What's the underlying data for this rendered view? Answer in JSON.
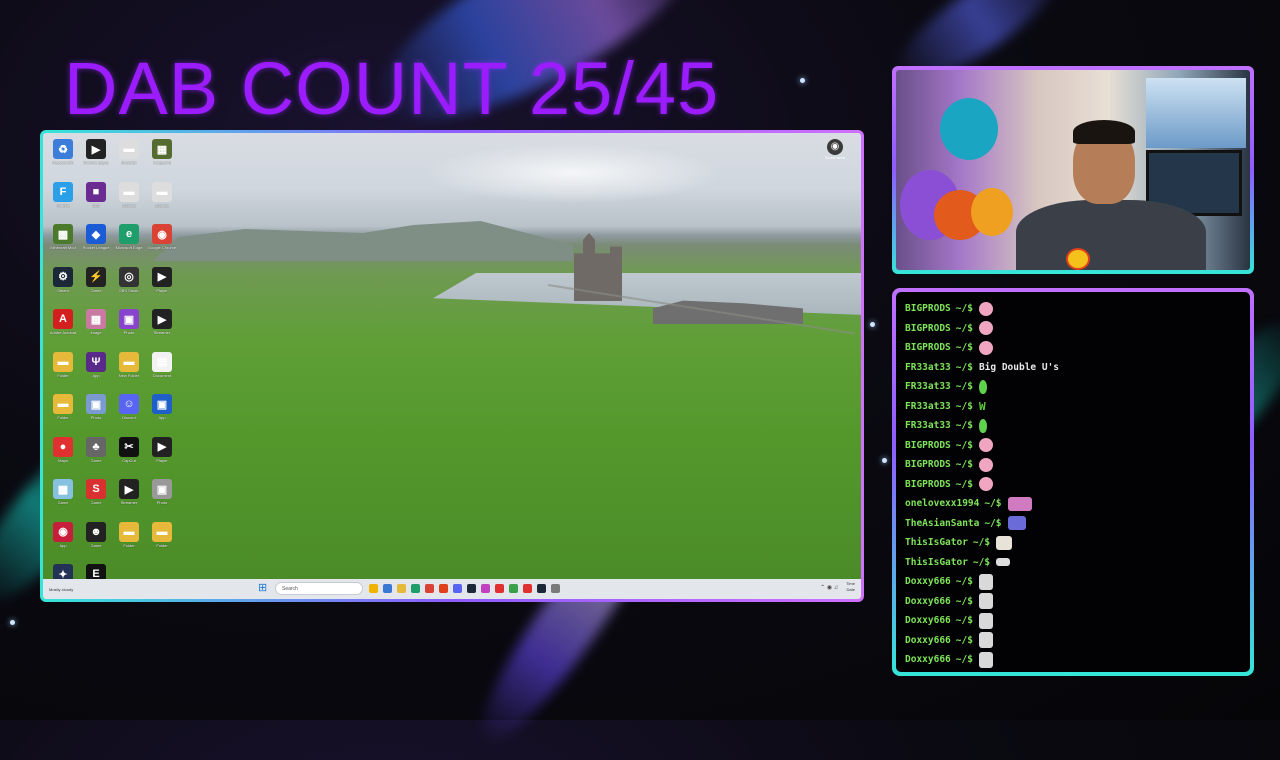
{
  "overlay": {
    "title": "DAB COUNT 25/45"
  },
  "desktop": {
    "icons": [
      {
        "label": "Recycle Bin",
        "icon": "recycle-bin-icon",
        "color": "#3b7dd8",
        "glyph": "♻"
      },
      {
        "label": "Chrome player",
        "icon": "player-icon",
        "color": "#222222",
        "glyph": "▶"
      },
      {
        "label": "Rockstar",
        "icon": "rockstar-icon",
        "color": "#dddddd",
        "glyph": "▬"
      },
      {
        "label": "Image.png",
        "icon": "image-icon",
        "color": "#556b2f",
        "glyph": "▦"
      },
      {
        "label": "Fortnite",
        "icon": "fortnite-icon",
        "color": "#2b9fe8",
        "glyph": "F"
      },
      {
        "label": "OBS",
        "icon": "app-icon",
        "color": "#6a2c91",
        "glyph": "■"
      },
      {
        "label": "Shortcut",
        "icon": "link-icon",
        "color": "#dddddd",
        "glyph": "▬"
      },
      {
        "label": "Shortcut",
        "icon": "link-icon",
        "color": "#dddddd",
        "glyph": "▬"
      },
      {
        "label": "Minecraft Mod",
        "icon": "game-icon",
        "color": "#4b7a2b",
        "glyph": "▩"
      },
      {
        "label": "Rocket League",
        "icon": "rocket-league-icon",
        "color": "#1c5bd6",
        "glyph": "◆"
      },
      {
        "label": "Microsoft Edge",
        "icon": "edge-icon",
        "color": "#1e9e6a",
        "glyph": "e"
      },
      {
        "label": "Google Chrome",
        "icon": "chrome-icon",
        "color": "#d94234",
        "glyph": "◉"
      },
      {
        "label": "Steam",
        "icon": "steam-icon",
        "color": "#1b2838",
        "glyph": "⚙"
      },
      {
        "label": "Game",
        "icon": "game-icon",
        "color": "#222222",
        "glyph": "⚡"
      },
      {
        "label": "OBS Studio",
        "icon": "obs-icon",
        "color": "#333333",
        "glyph": "◎"
      },
      {
        "label": "Player",
        "icon": "player-icon",
        "color": "#222222",
        "glyph": "▶"
      },
      {
        "label": "Adobe Acrobat",
        "icon": "acrobat-icon",
        "color": "#d41f1f",
        "glyph": "A"
      },
      {
        "label": "Image",
        "icon": "image-icon",
        "color": "#c97aa0",
        "glyph": "▦"
      },
      {
        "label": "Photo",
        "icon": "photo-icon",
        "color": "#8844cc",
        "glyph": "▣"
      },
      {
        "label": "Streamer",
        "icon": "player-icon",
        "color": "#222222",
        "glyph": "▶"
      },
      {
        "label": "Folder",
        "icon": "folder-icon",
        "color": "#e6b93a",
        "glyph": "▬"
      },
      {
        "label": "App",
        "icon": "app-icon",
        "color": "#5a2a8a",
        "glyph": "Ψ"
      },
      {
        "label": "New Folder",
        "icon": "folder-icon",
        "color": "#e6b93a",
        "glyph": "▬"
      },
      {
        "label": "Document",
        "icon": "document-icon",
        "color": "#f2f2f2",
        "glyph": "▤"
      },
      {
        "label": "Folder",
        "icon": "folder-icon",
        "color": "#e6b93a",
        "glyph": "▬"
      },
      {
        "label": "Photo",
        "icon": "photo-icon",
        "color": "#7a9ad0",
        "glyph": "▣"
      },
      {
        "label": "Discord",
        "icon": "discord-icon",
        "color": "#5865f2",
        "glyph": "☺"
      },
      {
        "label": "App",
        "icon": "app-icon",
        "color": "#1e5fc8",
        "glyph": "▣"
      },
      {
        "label": "Maps",
        "icon": "map-pin-icon",
        "color": "#e03030",
        "glyph": "●"
      },
      {
        "label": "Game",
        "icon": "game-icon",
        "color": "#666666",
        "glyph": "♣"
      },
      {
        "label": "CapCut",
        "icon": "capcut-icon",
        "color": "#111111",
        "glyph": "✂"
      },
      {
        "label": "Player",
        "icon": "player-icon",
        "color": "#222222",
        "glyph": "▶"
      },
      {
        "label": "Game",
        "icon": "game-icon",
        "color": "#88c0e0",
        "glyph": "▩"
      },
      {
        "label": "Game",
        "icon": "game-icon",
        "color": "#d93030",
        "glyph": "S"
      },
      {
        "label": "Streamer",
        "icon": "player-icon",
        "color": "#222222",
        "glyph": "▶"
      },
      {
        "label": "Photo",
        "icon": "photo-icon",
        "color": "#999999",
        "glyph": "▣"
      },
      {
        "label": "App",
        "icon": "app-icon",
        "color": "#c81e3c",
        "glyph": "◉"
      },
      {
        "label": "Game",
        "icon": "game-icon",
        "color": "#222222",
        "glyph": "☻"
      },
      {
        "label": "Folder",
        "icon": "folder-icon",
        "color": "#e6b93a",
        "glyph": "▬"
      },
      {
        "label": "Folder",
        "icon": "folder-icon",
        "color": "#e6b93a",
        "glyph": "▬"
      },
      {
        "label": "App",
        "icon": "app-icon",
        "color": "#223355",
        "glyph": "✦"
      },
      {
        "label": "Epic Games",
        "icon": "epic-games-icon",
        "color": "#111111",
        "glyph": "E"
      }
    ],
    "screenshot_widget": {
      "icon": "screenshot-icon",
      "glyph": "◉",
      "label": "Screenshot"
    },
    "taskbar": {
      "weather": "Mostly cloudy",
      "search_placeholder": "Search",
      "apps": [
        "#f0b400",
        "#3a78d4",
        "#e6b93a",
        "#1e9e6a",
        "#d94234",
        "#e0401a",
        "#5865f2",
        "#1b2838",
        "#c040c0",
        "#e03030",
        "#3aa04a",
        "#e03030",
        "#1b2838",
        "#7a7a7a"
      ],
      "time": "Time",
      "date": "Date"
    }
  },
  "webcam": {
    "caption": ""
  },
  "chat": {
    "prompt": "~/$",
    "messages": [
      {
        "user": "BIGPRODS",
        "emote": "e-pink",
        "text": ""
      },
      {
        "user": "BIGPRODS",
        "emote": "e-pink",
        "text": ""
      },
      {
        "user": "BIGPRODS",
        "emote": "e-pink",
        "text": ""
      },
      {
        "user": "FR33at33",
        "emote": "",
        "text": "Big Double U's"
      },
      {
        "user": "FR33at33",
        "emote": "e-green",
        "text": ""
      },
      {
        "user": "FR33at33",
        "emote": "e-w",
        "text": ""
      },
      {
        "user": "FR33at33",
        "emote": "e-green",
        "text": ""
      },
      {
        "user": "BIGPRODS",
        "emote": "e-pink",
        "text": ""
      },
      {
        "user": "BIGPRODS",
        "emote": "e-pink",
        "text": ""
      },
      {
        "user": "BIGPRODS",
        "emote": "e-pink",
        "text": ""
      },
      {
        "user": "onelovexx1994",
        "emote": "e-bear",
        "text": ""
      },
      {
        "user": "TheAsianSanta",
        "emote": "e-cat",
        "text": ""
      },
      {
        "user": "ThisIsGator",
        "emote": "e-hand",
        "text": ""
      },
      {
        "user": "ThisIsGator",
        "emote": "e-gun",
        "text": ""
      },
      {
        "user": "Doxxy666",
        "emote": "e-face",
        "text": ""
      },
      {
        "user": "Doxxy666",
        "emote": "e-face",
        "text": ""
      },
      {
        "user": "Doxxy666",
        "emote": "e-face",
        "text": ""
      },
      {
        "user": "Doxxy666",
        "emote": "e-face",
        "text": ""
      },
      {
        "user": "Doxxy666",
        "emote": "e-face",
        "text": ""
      }
    ]
  }
}
